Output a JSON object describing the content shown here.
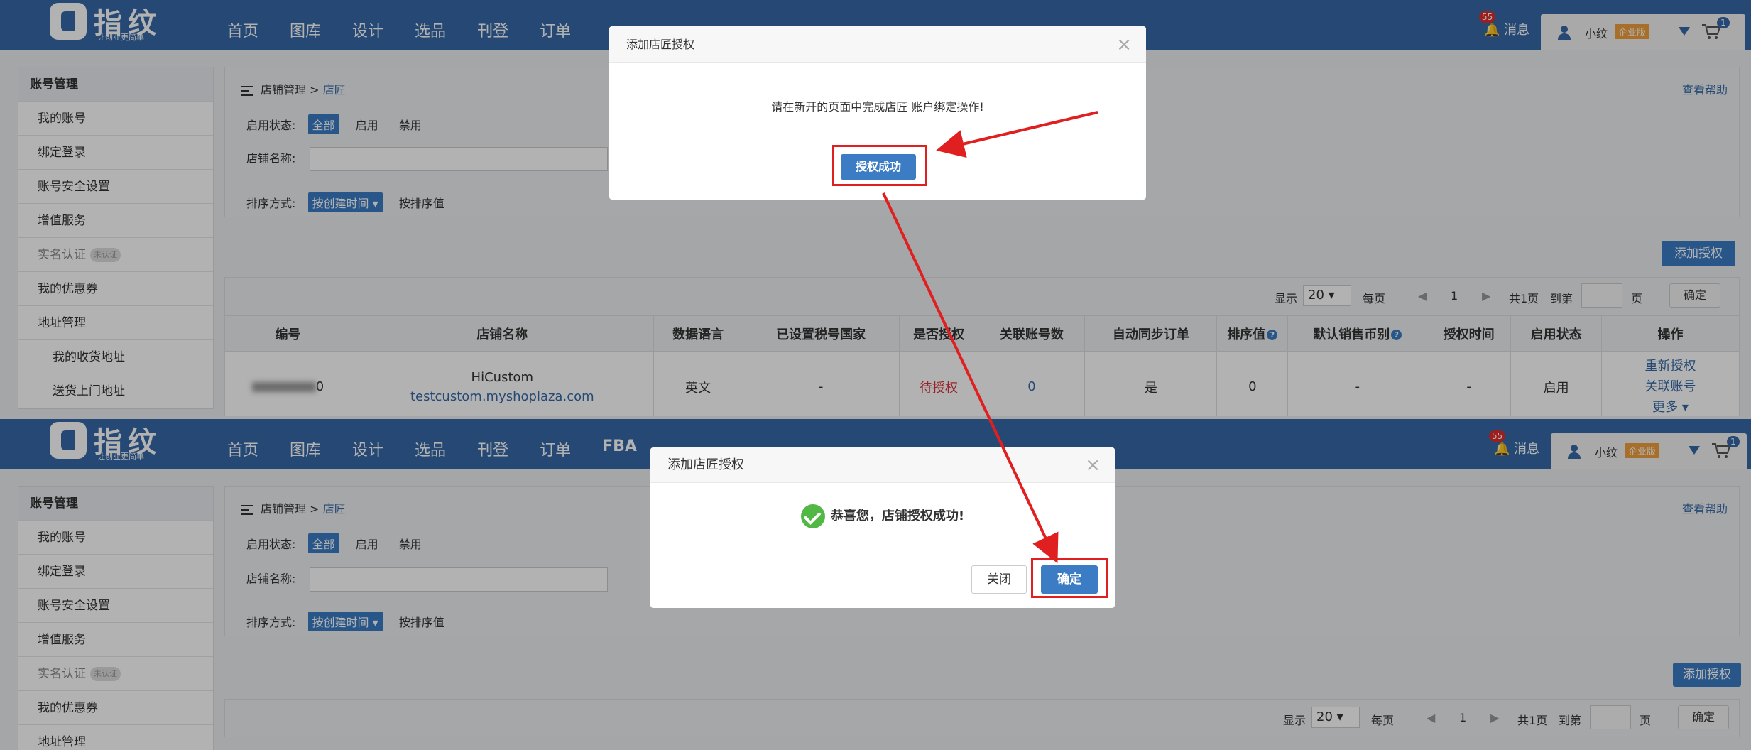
{
  "app": {
    "logo_text": "指纹",
    "logo_sub": "让创业更简单"
  },
  "nav": {
    "p1_items": [
      "首页",
      "图库",
      "设计",
      "选品",
      "刊登",
      "订单"
    ],
    "p2_items": [
      "首页",
      "图库",
      "设计",
      "选品",
      "刊登",
      "订单",
      "FBA"
    ],
    "msg_label": "消息",
    "msg_count": "55",
    "user_name": "小纹",
    "edition": "企业版",
    "cart_count": "1"
  },
  "sidebar": {
    "heading": "账号管理",
    "items": {
      "my_account": "我的账号",
      "bind_login": "绑定登录",
      "security": "账号安全设置",
      "value_added": "增值服务",
      "real_name": "实名认证",
      "real_name_badge": "未认证",
      "coupons": "我的优惠券",
      "address": "地址管理",
      "receive_address": "我的收货地址",
      "pickup_address": "送货上门地址"
    }
  },
  "breadcrumb": {
    "parent": "店铺管理",
    "sep": ">",
    "current": "店匠"
  },
  "help_link": "查看帮助",
  "filters": {
    "status_label": "启用状态:",
    "status_options": [
      "全部",
      "启用",
      "禁用"
    ],
    "name_label": "店铺名称:",
    "sort_label": "排序方式:",
    "sort_selected": "按创建时间",
    "sort_other": "按排序值"
  },
  "add_auth_button": "添加授权",
  "pagination": {
    "show": "显示",
    "page_size": "20",
    "per_page": "每页",
    "current": "1",
    "total": "共1页",
    "goto": "到第",
    "page_unit": "页",
    "confirm": "确定"
  },
  "table": {
    "headers": [
      "编号",
      "店铺名称",
      "数据语言",
      "已设置税号国家",
      "是否授权",
      "关联账号数",
      "自动同步订单",
      "排序值",
      "默认销售币别",
      "授权时间",
      "启用状态",
      "操作"
    ],
    "row": {
      "id_suffix": "0",
      "shop_name": "HiCustom",
      "shop_url": "testcustom.myshoplaza.com",
      "language": "英文",
      "tax_country": "-",
      "auth_status": "待授权",
      "linked_accounts": "0",
      "auto_sync": "是",
      "sort_value": "0",
      "currency": "-",
      "auth_time": "-",
      "enabled": "启用",
      "actions": {
        "reauth": "重新授权",
        "link_account": "关联账号",
        "more": "更多"
      }
    }
  },
  "dialog1": {
    "title": "添加店匠授权",
    "message": "请在新开的页面中完成店匠 账户绑定操作!",
    "button": "授权成功"
  },
  "dialog2": {
    "title": "添加店匠授权",
    "message": "恭喜您，店铺授权成功!",
    "close_button": "关闭",
    "ok_button": "确定"
  },
  "colors": {
    "nav_bg": "#3569a6",
    "primary": "#3b7cc4",
    "annotation_red": "#e02020",
    "success": "#52b845"
  }
}
